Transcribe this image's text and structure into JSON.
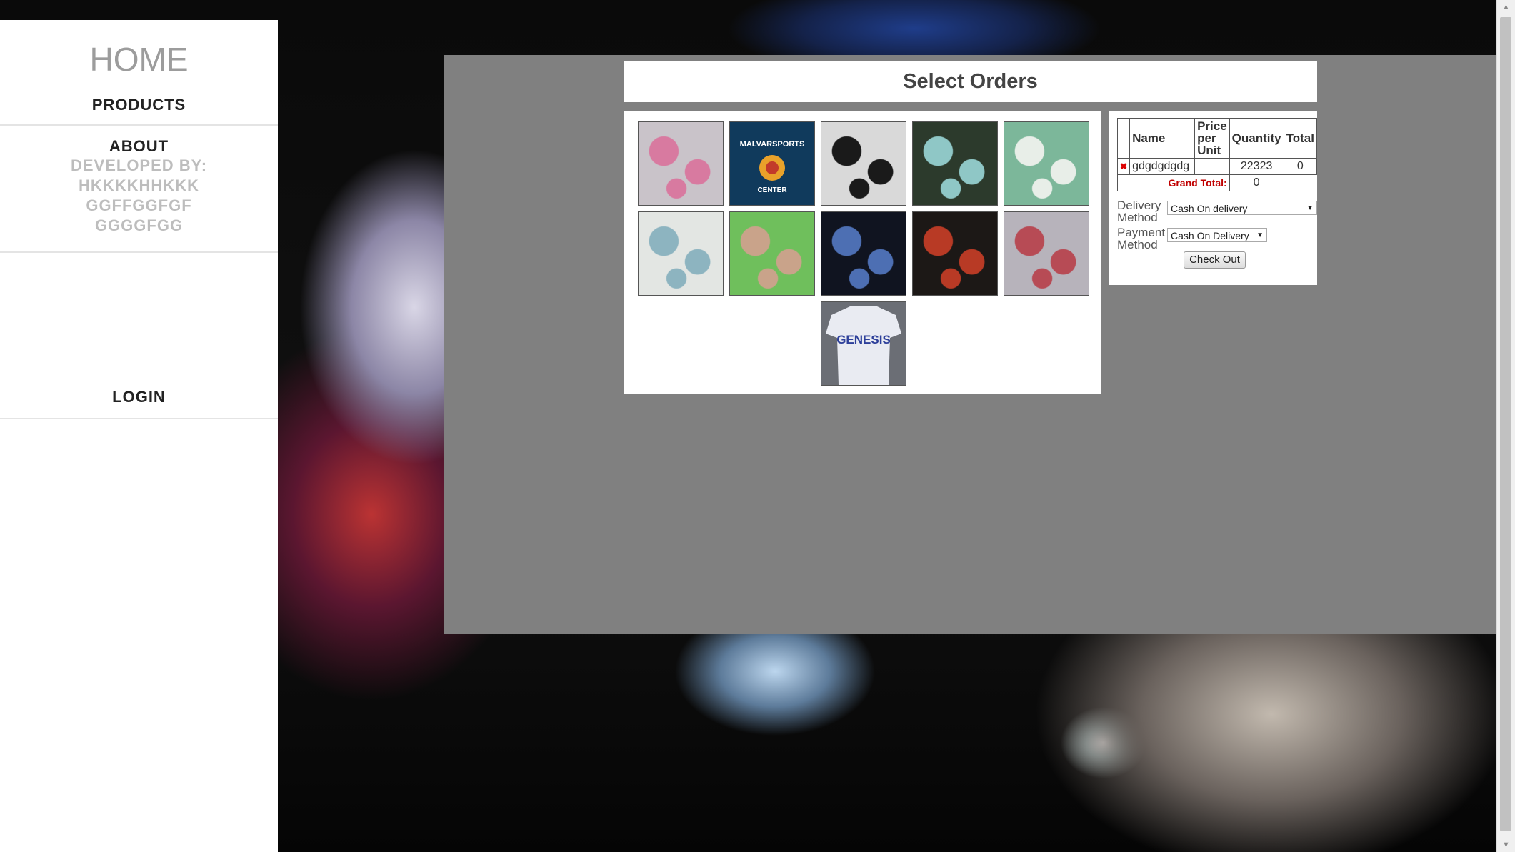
{
  "nav": {
    "home": "HOME",
    "products": "PRODUCTS",
    "about": "ABOUT",
    "developed_lines": [
      "DEVELOPED BY:",
      "HKKKKHHKKK",
      "GGFFGGFGF",
      "GGGGFGG"
    ],
    "login": "LOGIN"
  },
  "modal": {
    "title": "Select Orders",
    "products": [
      {
        "name": "keychains-photo",
        "colors": [
          "#c9c3c9",
          "#d87aa0"
        ]
      },
      {
        "name": "malvar-sports-logo",
        "colors": [
          "#103a5c",
          "#e9a22a"
        ],
        "label_top": "MALVARSPORTS",
        "label_bottom": "CENTER"
      },
      {
        "name": "mugs-black-white",
        "colors": [
          "#d9d9d9",
          "#1a1a1a"
        ]
      },
      {
        "name": "mugs-stack-cars",
        "colors": [
          "#2c3a2c",
          "#8fc7c6"
        ]
      },
      {
        "name": "heart-keychains",
        "colors": [
          "#7cb79a",
          "#e8eee8"
        ]
      },
      {
        "name": "mug-stack-white",
        "colors": [
          "#e3e6e3",
          "#8db4c0"
        ]
      },
      {
        "name": "heart-keychain-couple",
        "colors": [
          "#6fbf5c",
          "#c9a38a"
        ]
      },
      {
        "name": "assorted-items",
        "colors": [
          "#101420",
          "#4d6fb3"
        ]
      },
      {
        "name": "cars-mug",
        "colors": [
          "#1c1816",
          "#b83a25"
        ]
      },
      {
        "name": "photo-keychains",
        "colors": [
          "#b7b3bb",
          "#b74b55"
        ]
      },
      {
        "name": "genesis-tshirt",
        "colors": [
          "#e9ebf2",
          "#2d3f9a"
        ],
        "label": "GENESIS"
      }
    ]
  },
  "order": {
    "headers": [
      "Name",
      "Price per Unit",
      "Quantity",
      "Total"
    ],
    "rows": [
      {
        "name": "gdgdgdgdg",
        "price": "",
        "quantity": "22323",
        "total": "0"
      }
    ],
    "grand_total_label": "Grand Total:",
    "grand_total": "0",
    "delivery_label_1": "Delivery",
    "delivery_label_2": "Method",
    "delivery_value": "Cash On delivery",
    "payment_label_1": "Payment",
    "payment_label_2": "Method",
    "payment_value": "Cash On Delivery",
    "checkout_label": "Check Out"
  },
  "colors": {
    "overlay": "#808080",
    "sidebar_bg": "#ffffff",
    "grand_total": "#c00000",
    "remove_icon": "#dd0000"
  }
}
